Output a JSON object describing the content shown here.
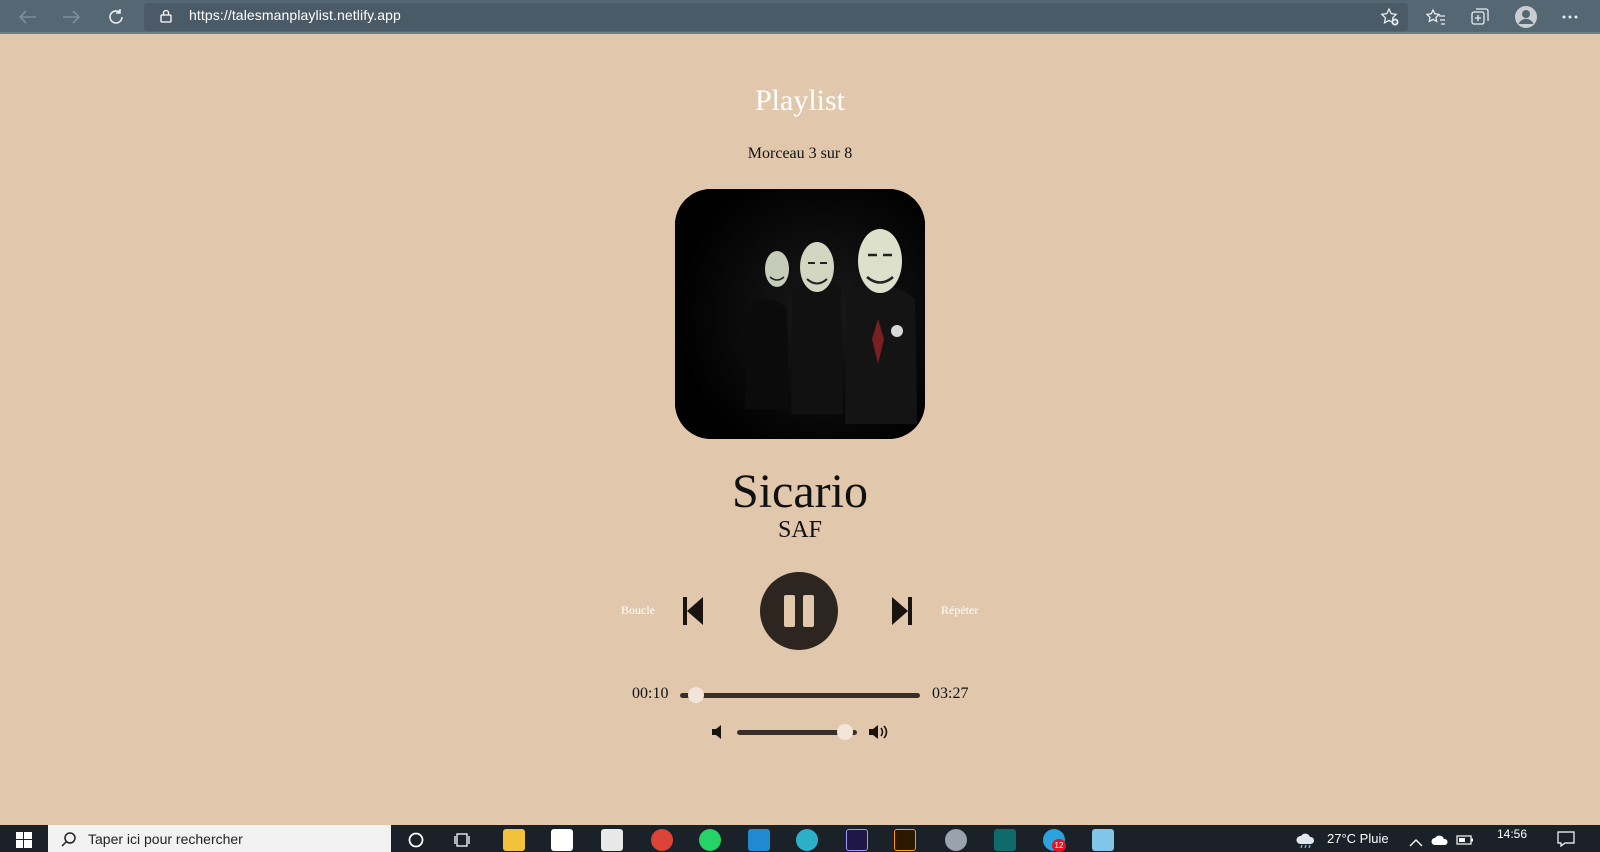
{
  "browser": {
    "url": "https://talesmanplaylist.netlify.app"
  },
  "player": {
    "heading": "Playlist",
    "counter": "Morceau 3 sur 8",
    "track_title": "Sicario",
    "artist": "SAF",
    "loop_label": "Boucle",
    "repeat_label": "Répéter",
    "current_time": "00:10",
    "duration": "03:27",
    "progress": 0.05,
    "volume": 0.9,
    "state": "playing"
  },
  "taskbar": {
    "search_placeholder": "Taper ici pour rechercher",
    "weather": "27°C  Pluie",
    "clock_time": "14:56",
    "notification_count": "12"
  },
  "colors": {
    "background": "#e1c8ad",
    "dark": "#2d2520",
    "browser": "#566774"
  }
}
